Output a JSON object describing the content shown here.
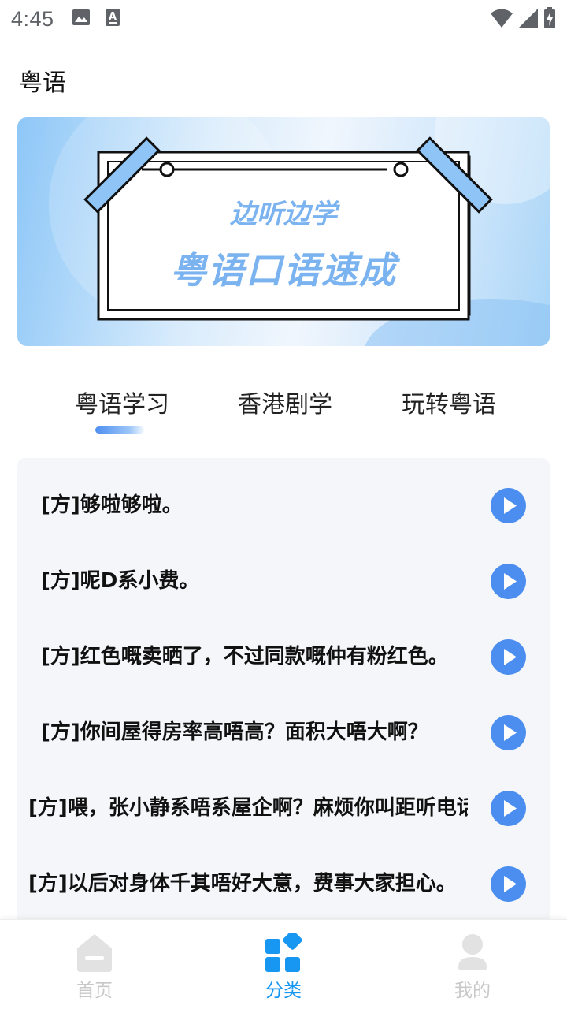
{
  "status_bar": {
    "time": "4:45",
    "left_icons": [
      "image-icon",
      "a-font-icon"
    ],
    "right_icons": [
      "wifi-icon",
      "signal-icon",
      "battery-charging-icon"
    ]
  },
  "header": {
    "title": "粤语"
  },
  "banner": {
    "line1": "边听边学",
    "line2": "粤语口语速成",
    "text_color": "#7ab3ef"
  },
  "tabs": [
    {
      "label": "粤语学习",
      "active": true
    },
    {
      "label": "香港剧学",
      "active": false
    },
    {
      "label": "玩转粤语",
      "active": false
    }
  ],
  "phrases": [
    {
      "text": "[方]够啦够啦。"
    },
    {
      "text": "[方]呢D系小费。"
    },
    {
      "text": "[方]红色嘅卖晒了，不过同款嘅仲有粉红色。"
    },
    {
      "text": "[方]你间屋得房率高唔高？面积大唔大啊？"
    },
    {
      "text": "[方]喂，张小静系唔系屋企啊？麻烦你叫距听电话"
    },
    {
      "text": "[方]以后对身体千其唔好大意，费事大家担心。"
    }
  ],
  "bottom_nav": [
    {
      "label": "首页",
      "icon": "home-icon",
      "active": false
    },
    {
      "label": "分类",
      "icon": "category-icon",
      "active": true
    },
    {
      "label": "我的",
      "icon": "profile-icon",
      "active": false
    }
  ],
  "colors": {
    "accent": "#1796f2",
    "play_button": "#4b8ef0",
    "list_background": "#f5f6f9",
    "inactive_nav": "#c8c8c8"
  }
}
